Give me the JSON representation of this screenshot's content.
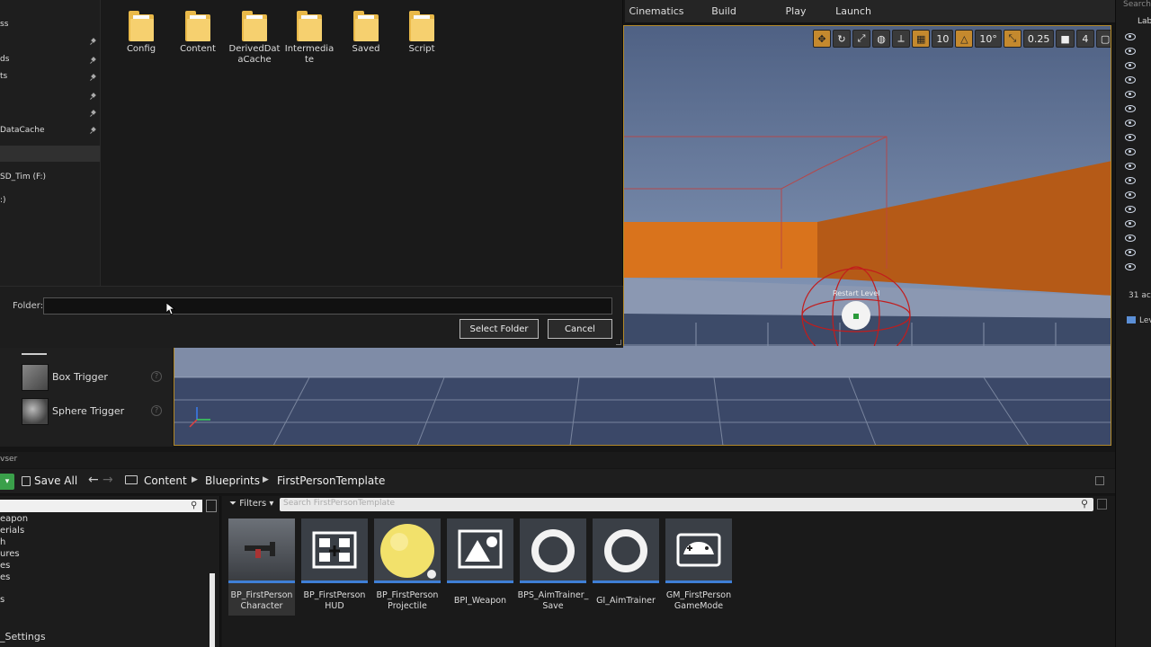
{
  "toolbar": {
    "buttons": [
      {
        "label": "Cinematics"
      },
      {
        "label": "Build"
      },
      {
        "label": "Play"
      },
      {
        "label": "Launch"
      }
    ]
  },
  "viewport": {
    "toolbar": {
      "grid_snap": "10",
      "rotation_snap": "10°",
      "scale_snap": "0.25",
      "camera_speed": "4"
    },
    "label_in_scene": "Restart Level"
  },
  "right_panel": {
    "search_placeholder": "Search",
    "tab_label": "Lab",
    "actor_count": "31 ac",
    "footer_label": "Lev"
  },
  "dialog": {
    "nav_items": [
      "ss",
      "ds",
      "ts",
      "",
      "DataCache",
      "",
      "SD_Tim (F:)",
      ":)"
    ],
    "folders": [
      {
        "name": "Config"
      },
      {
        "name": "Content"
      },
      {
        "name": "DerivedDataCache"
      },
      {
        "name": "Intermediate"
      },
      {
        "name": "Saved"
      },
      {
        "name": "Script"
      }
    ],
    "folder_label": "Folder:",
    "folder_value": "",
    "select_button": "Select Folder",
    "cancel_button": "Cancel"
  },
  "place_panel": {
    "items": [
      {
        "label": "Box Trigger"
      },
      {
        "label": "Sphere Trigger"
      }
    ]
  },
  "content_browser": {
    "tab_label": "vser",
    "save_all": "Save All",
    "breadcrumb": [
      "Content",
      "Blueprints",
      "FirstPersonTemplate"
    ],
    "filters_label": "Filters",
    "search_placeholder": "Search FirstPersonTemplate",
    "tree_items": [
      "eapon",
      "erials",
      "h",
      "ures",
      "es",
      "es",
      "s",
      "_Settings"
    ],
    "assets": [
      {
        "name": "BP_FirstPerson Character",
        "icon": "character-thumbnail"
      },
      {
        "name": "BP_FirstPerson HUD",
        "icon": "hud-icon"
      },
      {
        "name": "BP_FirstPerson Projectile",
        "icon": "sphere-thumbnail"
      },
      {
        "name": "BPI_Weapon",
        "icon": "interface-icon"
      },
      {
        "name": "BPS_AimTrainer_ Save",
        "icon": "ring-icon"
      },
      {
        "name": "GI_AimTrainer",
        "icon": "ring-icon"
      },
      {
        "name": "GM_FirstPerson GameMode",
        "icon": "gamepad-icon"
      }
    ]
  }
}
